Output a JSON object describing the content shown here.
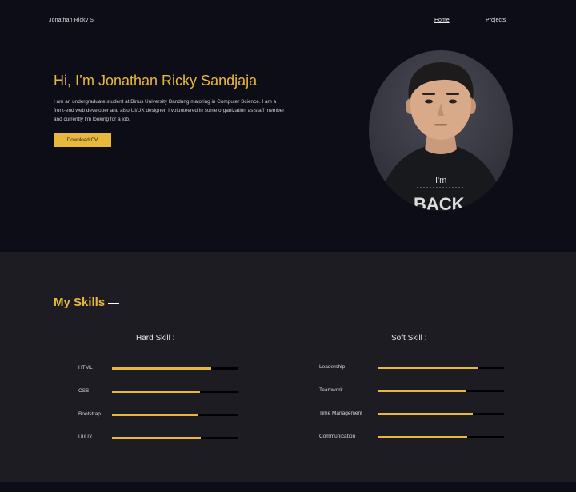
{
  "nav": {
    "brand": "Jonathan Ricky S",
    "home": "Home",
    "projects": "Projects"
  },
  "hero": {
    "title": "Hi, I’m Jonathan Ricky Sandjaja",
    "description": "I am an undergraduate student at Binus University Bandung majoring in Computer Science. I am a front-end web developer and also UI/UX designer. I volunteered in some organization as staff member and currently I'm looking for a job.",
    "cv_button": "Download CV",
    "shirt_text_top": "I'm",
    "shirt_text_bottom": "BACK"
  },
  "skills": {
    "title": "My Skills",
    "hard": {
      "heading": "Hard Skill :",
      "items": [
        {
          "label": "HTML",
          "level": 0.79
        },
        {
          "label": "CSS",
          "level": 0.7
        },
        {
          "label": "Bootstrap",
          "level": 0.68
        },
        {
          "label": "UI/UX",
          "level": 0.71
        }
      ]
    },
    "soft": {
      "heading": "Soft Skill :",
      "items": [
        {
          "label": "Leadership",
          "level": 0.79
        },
        {
          "label": "Teamwork",
          "level": 0.7
        },
        {
          "label": "Time Management",
          "level": 0.75
        },
        {
          "label": "Communication",
          "level": 0.71
        }
      ]
    }
  },
  "colors": {
    "accent": "#e7b83c",
    "hero_bg": "#0c0d16",
    "skills_bg": "#1d1c23",
    "bar_track": "#000000"
  }
}
